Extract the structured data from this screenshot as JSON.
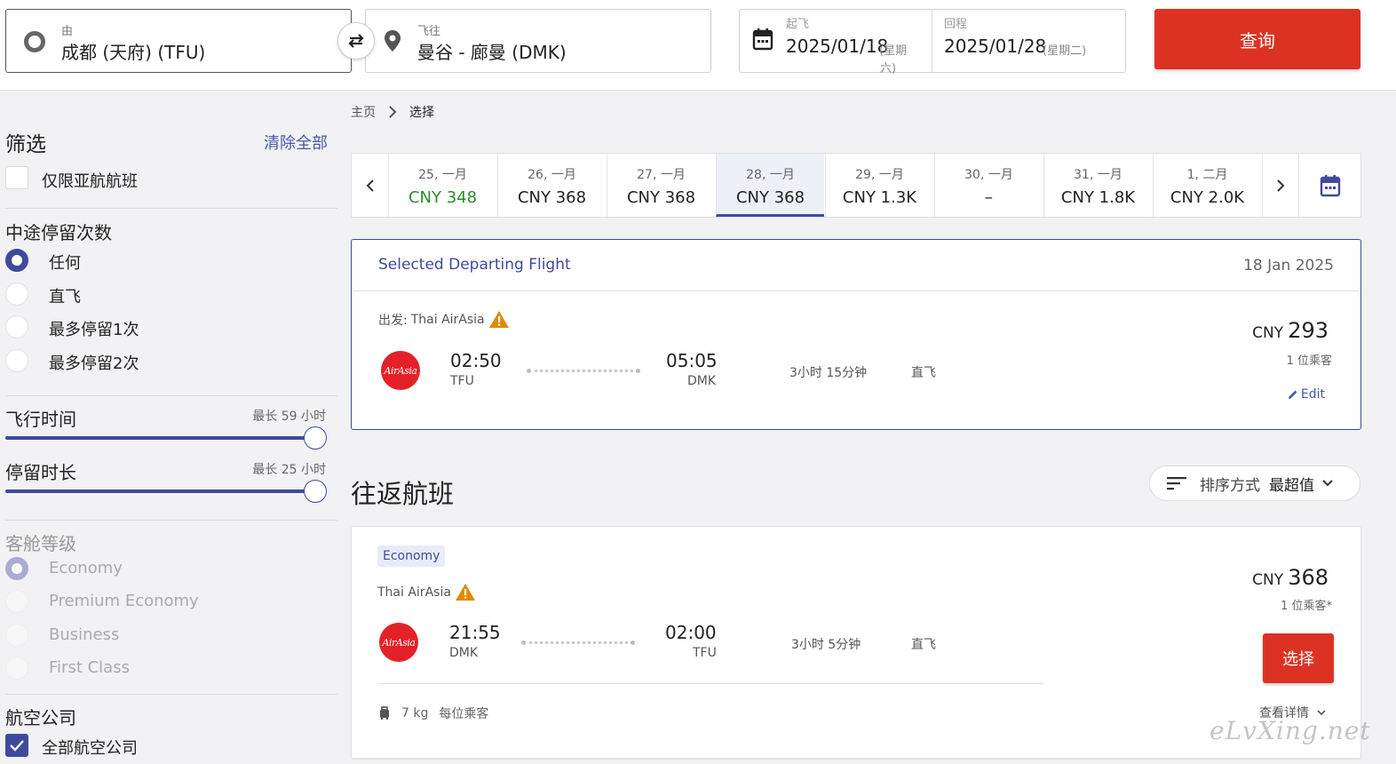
{
  "search": {
    "from_label": "由",
    "from_value": "成都 (天府) (TFU)",
    "to_label": "飞往",
    "to_value": "曼谷 - 廊曼 (DMK)",
    "depart_label": "起飞",
    "depart_value": "2025/01/18",
    "depart_weekday": "(星期六)",
    "depart_weekday_a": "(星期",
    "depart_weekday_b": "六)",
    "return_label": "回程",
    "return_value": "2025/01/28",
    "return_weekday": "(星期二)",
    "search_button": "查询"
  },
  "filters": {
    "title": "筛选",
    "clear_all": "清除全部",
    "airasia_only": "仅限亚航航班",
    "stops_heading": "中途停留次数",
    "stops_options": [
      "任何",
      "直飞",
      "最多停留1次",
      "最多停留2次"
    ],
    "flight_time_heading": "飞行时间",
    "flight_time_max": "最长 59 小时",
    "layover_heading": "停留时长",
    "layover_max": "最长 25 小时",
    "cabin_heading": "客舱等级",
    "cabin_options": [
      "Economy",
      "Premium Economy",
      "Business",
      "First Class"
    ],
    "airline_heading": "航空公司",
    "all_airlines": "全部航空公司"
  },
  "breadcrumb": {
    "home": "主页",
    "current": "选择"
  },
  "date_strip": [
    {
      "date": "25, 一月",
      "price": "CNY 348"
    },
    {
      "date": "26, 一月",
      "price": "CNY 368"
    },
    {
      "date": "27, 一月",
      "price": "CNY 368"
    },
    {
      "date": "28, 一月",
      "price": "CNY 368"
    },
    {
      "date": "29, 一月",
      "price": "CNY 1.3K"
    },
    {
      "date": "30, 一月",
      "price": "–"
    },
    {
      "date": "31, 一月",
      "price": "CNY 1.8K"
    },
    {
      "date": "1, 二月",
      "price": "CNY 2.0K"
    }
  ],
  "selected_flight": {
    "title": "Selected Departing Flight",
    "date": "18 Jan 2025",
    "airline_prefix": "出发: ",
    "airline": "Thai AirAsia",
    "logo_text": "AirAsia",
    "depart_time": "02:50",
    "depart_code": "TFU",
    "arrive_time": "05:05",
    "arrive_code": "DMK",
    "duration": "3小时 15分钟",
    "stops": "直飞",
    "currency": "CNY",
    "price": "293",
    "pax": "1 位乘客",
    "edit": "Edit"
  },
  "return_section": {
    "title": "往返航班",
    "sort_label": "排序方式",
    "sort_value": "最超值"
  },
  "return_flight": {
    "cabin": "Economy",
    "airline": "Thai AirAsia",
    "logo_text": "AirAsia",
    "depart_time": "21:55",
    "depart_code": "DMK",
    "arrive_time": "02:00",
    "arrive_code": "TFU",
    "duration": "3小时 5分钟",
    "stops": "直飞",
    "currency": "CNY",
    "price": "368",
    "pax": "1 位乘客*",
    "select_button": "选择",
    "baggage": "7 kg",
    "baggage_per": "每位乘客",
    "details": "查看详情"
  },
  "watermark": "eLvXing.net",
  "colors": {
    "accent": "#3f4a9e",
    "cta": "#dc3224",
    "cheapest": "#2e8b2e",
    "warning": "#e08a00"
  }
}
